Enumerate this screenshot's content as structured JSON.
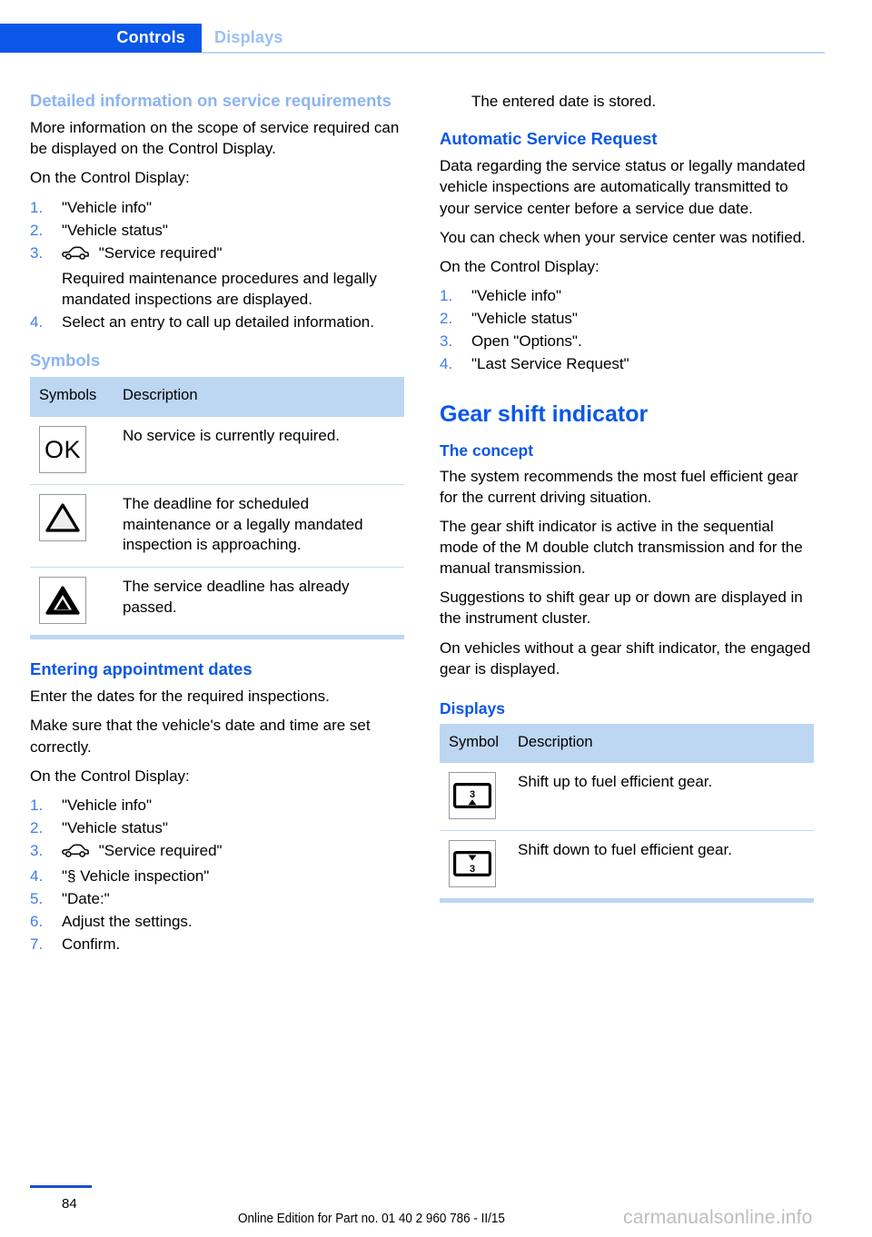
{
  "header": {
    "active_tab": "Controls",
    "inactive_tab": "Displays"
  },
  "left_column": {
    "heading_detailed_info": "Detailed information on service requirements",
    "para_more_info": "More information on the scope of service required can be displayed on the Control Display.",
    "label_on_control_display": "On the Control Display:",
    "steps_detailed": [
      {
        "num": "1.",
        "text": "\"Vehicle info\""
      },
      {
        "num": "2.",
        "text": "\"Vehicle status\""
      },
      {
        "num": "3.",
        "text": "\"Service required\"",
        "icon": "car-icon",
        "note": "Required maintenance procedures and legally mandated inspections are displayed."
      },
      {
        "num": "4.",
        "text": "Select an entry to call up detailed information."
      }
    ],
    "heading_symbols": "Symbols",
    "symbols_table": {
      "col_symbol": "Symbols",
      "col_description": "Description",
      "rows": [
        {
          "symbol": "ok-symbol",
          "symbol_text": "OK",
          "description": "No service is currently required."
        },
        {
          "symbol": "warning-triangle-outline-symbol",
          "symbol_text": "",
          "description": "The deadline for scheduled maintenance or a legally mandated inspection is approaching."
        },
        {
          "symbol": "warning-triangle-filled-symbol",
          "symbol_text": "",
          "description": "The service deadline has already passed."
        }
      ]
    },
    "heading_entering_dates": "Entering appointment dates",
    "para_enter_dates": "Enter the dates for the required inspections.",
    "para_make_sure": "Make sure that the vehicle's date and time are set correctly.",
    "label_on_control_display_2": "On the Control Display:",
    "steps_dates": [
      {
        "num": "1.",
        "text": "\"Vehicle info\""
      },
      {
        "num": "2.",
        "text": "\"Vehicle status\""
      },
      {
        "num": "3.",
        "text": "\"Service required\"",
        "icon": "car-icon"
      },
      {
        "num": "4.",
        "text": "\"§ Vehicle inspection\""
      },
      {
        "num": "5.",
        "text": "\"Date:\""
      },
      {
        "num": "6.",
        "text": "Adjust the settings."
      },
      {
        "num": "7.",
        "text": "Confirm."
      }
    ]
  },
  "right_column": {
    "para_date_stored": "The entered date is stored.",
    "heading_auto_service": "Automatic Service Request",
    "para_data_regarding": "Data regarding the service status or legally mandated vehicle inspections are automatically transmitted to your service center before a service due date.",
    "para_you_can_check": "You can check when your service center was notified.",
    "label_on_control_display": "On the Control Display:",
    "steps_auto": [
      {
        "num": "1.",
        "text": "\"Vehicle info\""
      },
      {
        "num": "2.",
        "text": "\"Vehicle status\""
      },
      {
        "num": "3.",
        "text": "Open \"Options\"."
      },
      {
        "num": "4.",
        "text": "\"Last Service Request\""
      }
    ],
    "heading_gear_shift": "Gear shift indicator",
    "heading_the_concept": "The concept",
    "para_system_recommends": "The system recommends the most fuel efficient gear for the current driving situation.",
    "para_gsi_active": "The gear shift indicator is active in the sequential mode of the M double clutch transmission and for the manual transmission.",
    "para_suggestions": "Suggestions to shift gear up or down are displayed in the instrument cluster.",
    "para_without_gsi": "On vehicles without a gear shift indicator, the engaged gear is displayed.",
    "heading_displays": "Displays",
    "displays_table": {
      "col_symbol": "Symbol",
      "col_description": "Description",
      "rows": [
        {
          "symbol": "shift-up-symbol",
          "gear": "3",
          "arrow": "up",
          "description": "Shift up to fuel efficient gear."
        },
        {
          "symbol": "shift-down-symbol",
          "gear": "3",
          "arrow": "down",
          "description": "Shift down to fuel efficient gear."
        }
      ]
    }
  },
  "footer": {
    "page_number": "84",
    "edition": "Online Edition for Part no. 01 40 2 960 786 - II/15",
    "watermark": "carmanualsonline.info"
  }
}
